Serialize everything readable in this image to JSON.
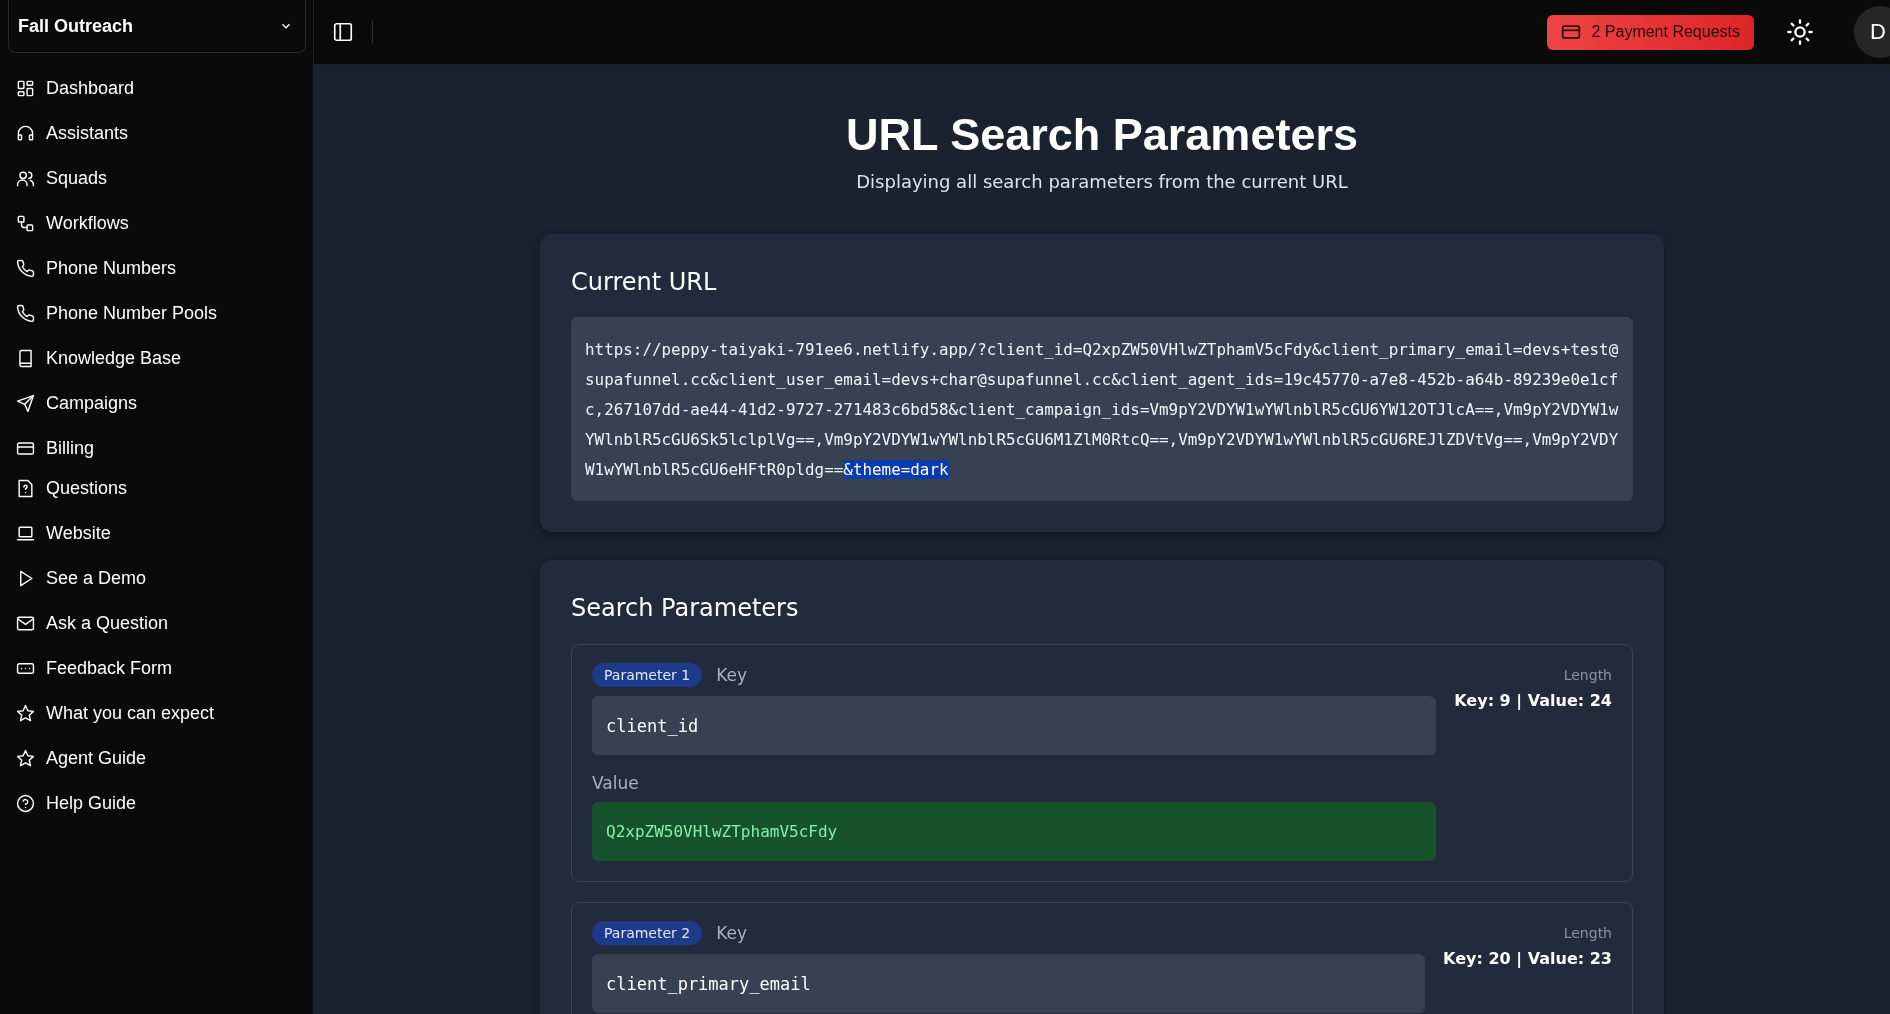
{
  "workspace": {
    "name": "Fall Outreach"
  },
  "sidebar": {
    "items": [
      {
        "label": "Dashboard"
      },
      {
        "label": "Assistants"
      },
      {
        "label": "Squads"
      },
      {
        "label": "Workflows"
      },
      {
        "label": "Phone Numbers"
      },
      {
        "label": "Phone Number Pools"
      },
      {
        "label": "Knowledge Base"
      },
      {
        "label": "Campaigns"
      },
      {
        "label": "Billing"
      },
      {
        "label": "Questions"
      },
      {
        "label": "Website"
      },
      {
        "label": "See a Demo"
      },
      {
        "label": "Ask a Question"
      },
      {
        "label": "Feedback Form"
      },
      {
        "label": "What you can expect"
      },
      {
        "label": "Agent Guide"
      },
      {
        "label": "Help Guide"
      }
    ]
  },
  "topbar": {
    "payment_button": "2 Payment Requests",
    "avatar": "D"
  },
  "page": {
    "title": "URL Search Parameters",
    "subtitle": "Displaying all search parameters from the current URL"
  },
  "current_url": {
    "heading": "Current URL",
    "text": "https://peppy-taiyaki-791ee6.netlify.app/?client_id=Q2xpZW50VHlwZTphamV5cFdy&client_primary_email=devs+test@supafunnel.cc&client_user_email=devs+char@supafunnel.cc&client_agent_ids=19c45770-a7e8-452b-a64b-89239e0e1cfc,267107dd-ae44-41d2-9727-271483c6bd58&client_campaign_ids=Vm9pY2VDYW1wYWlnblR5cGU6YW12OTJlcA==,Vm9pY2VDYW1wYWlnblR5cGU6Sk5lclplVg==,Vm9pY2VDYW1wYWlnblR5cGU6M1ZlM0RtcQ==,Vm9pY2VDYW1wYWlnblR5cGU6REJlZDVtVg==,Vm9pY2VDYW1wYWlnblR5cGU6eHFtR0pldg==",
    "selected_text": "&theme=dark"
  },
  "search_parameters": {
    "heading": "Search Parameters",
    "parameters": [
      {
        "badge": "Parameter 1",
        "key_label": "Key",
        "key": "client_id",
        "value_label": "Value",
        "value": "Q2xpZW50VHlwZTphamV5cFdy",
        "length_label": "Length",
        "length": "Key: 9 | Value: 24"
      },
      {
        "badge": "Parameter 2",
        "key_label": "Key",
        "key": "client_primary_email",
        "length_label": "Length",
        "length": "Key: 20 | Value: 23"
      }
    ]
  }
}
